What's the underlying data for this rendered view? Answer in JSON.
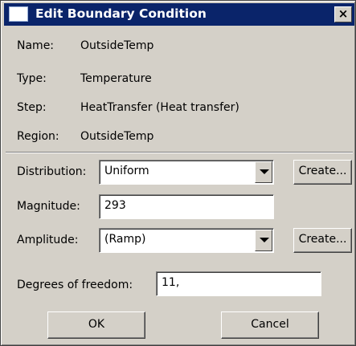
{
  "window": {
    "title": "Edit Boundary Condition",
    "close_glyph": "×",
    "icon": "window-icon"
  },
  "info": {
    "name": {
      "label": "Name:",
      "value": "OutsideTemp"
    },
    "type": {
      "label": "Type:",
      "value": "Temperature"
    },
    "step": {
      "label": "Step:",
      "value": "HeatTransfer (Heat transfer)"
    },
    "region": {
      "label": "Region:",
      "value": "OutsideTemp"
    }
  },
  "distribution": {
    "label": "Distribution:",
    "value": "Uniform",
    "create_label": "Create..."
  },
  "magnitude": {
    "label": "Magnitude:",
    "value": "293"
  },
  "amplitude": {
    "label": "Amplitude:",
    "value": "(Ramp)",
    "create_label": "Create..."
  },
  "dof": {
    "label": "Degrees of freedom:",
    "value": "11,"
  },
  "buttons": {
    "ok": "OK",
    "cancel": "Cancel"
  },
  "colors": {
    "titlebar": "#0a246a",
    "face": "#d4d0c8",
    "field": "#ffffff"
  }
}
